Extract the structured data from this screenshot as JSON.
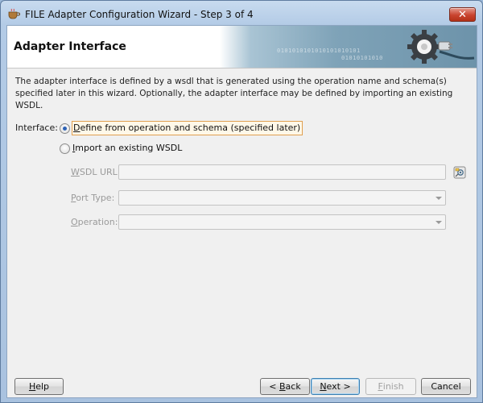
{
  "window": {
    "title": "FILE Adapter Configuration Wizard - Step 3 of 4",
    "close_glyph": "✕"
  },
  "header": {
    "title": "Adapter Interface",
    "binary_deco_1": "0101010101010101010101",
    "binary_deco_2": "01010101010"
  },
  "main": {
    "description": "The adapter interface is defined by a wsdl that is generated using the operation name and schema(s) specified later in this wizard.  Optionally, the adapter interface may be defined by importing an existing WSDL.",
    "interface_label": "Interface:",
    "options": [
      {
        "mnemonic": "D",
        "rest": "efine from operation and schema (specified later)",
        "selected": true
      },
      {
        "mnemonic": "I",
        "rest": "mport an existing WSDL",
        "selected": false
      }
    ],
    "wsdl_url": {
      "mnemonic": "W",
      "rest": "SDL URL:",
      "value": ""
    },
    "port_type": {
      "mnemonic": "P",
      "rest": "ort Type:",
      "value": ""
    },
    "operation": {
      "mnemonic": "O",
      "rest": "peration:",
      "value": ""
    }
  },
  "footer": {
    "help": {
      "mnemonic": "H",
      "rest": "elp"
    },
    "back": {
      "prefix": "< ",
      "mnemonic": "B",
      "rest": "ack"
    },
    "next": {
      "mnemonic": "N",
      "rest": "ext >"
    },
    "finish": {
      "mnemonic": "F",
      "rest": "inish"
    },
    "cancel": "Cancel"
  },
  "colors": {
    "selected_radio": "#2d62b5",
    "focus_border": "#e0a050",
    "banner_blue": "#7fa3b8"
  }
}
